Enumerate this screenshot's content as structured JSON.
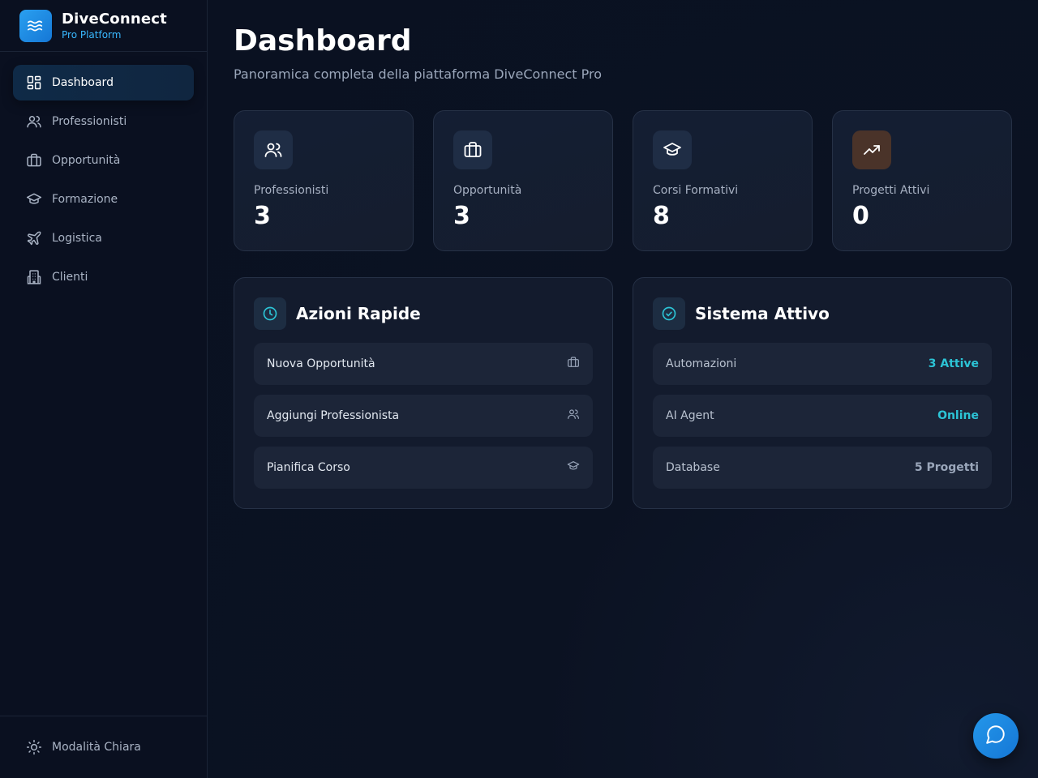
{
  "brand": {
    "name": "DiveConnect",
    "subtitle": "Pro Platform"
  },
  "sidebar": {
    "items": [
      {
        "label": "Dashboard",
        "icon": "dashboard-grid-icon",
        "active": true
      },
      {
        "label": "Professionisti",
        "icon": "users-icon"
      },
      {
        "label": "Opportunità",
        "icon": "briefcase-icon"
      },
      {
        "label": "Formazione",
        "icon": "graduation-cap-icon"
      },
      {
        "label": "Logistica",
        "icon": "plane-icon"
      },
      {
        "label": "Clienti",
        "icon": "building-icon"
      }
    ],
    "footer": {
      "label": "Modalità Chiara",
      "icon": "sun-icon"
    }
  },
  "page": {
    "title": "Dashboard",
    "subtitle": "Panoramica completa della piattaforma DiveConnect Pro"
  },
  "stats": [
    {
      "label": "Professionisti",
      "value": "3",
      "icon": "users-icon"
    },
    {
      "label": "Opportunità",
      "value": "3",
      "icon": "briefcase-icon"
    },
    {
      "label": "Corsi Formativi",
      "value": "8",
      "icon": "graduation-cap-icon"
    },
    {
      "label": "Progetti Attivi",
      "value": "0",
      "icon": "trending-up-icon"
    }
  ],
  "quick_actions": {
    "title": "Azioni Rapide",
    "icon": "clock-icon",
    "items": [
      {
        "label": "Nuova Opportunità",
        "icon": "briefcase-icon"
      },
      {
        "label": "Aggiungi Professionista",
        "icon": "users-icon"
      },
      {
        "label": "Pianifica Corso",
        "icon": "graduation-cap-icon"
      }
    ]
  },
  "system": {
    "title": "Sistema Attivo",
    "icon": "check-circle-icon",
    "items": [
      {
        "label": "Automazioni",
        "value": "3 Attive"
      },
      {
        "label": "AI Agent",
        "value": "Online"
      },
      {
        "label": "Database",
        "value": "5 Progetti"
      }
    ]
  },
  "colors": {
    "accent": "#39b8ff",
    "cyan": "#2cc4d6",
    "background": "#0b1222",
    "card": "#131b2d"
  },
  "chat_button": {
    "icon": "chat-bubble-icon"
  }
}
